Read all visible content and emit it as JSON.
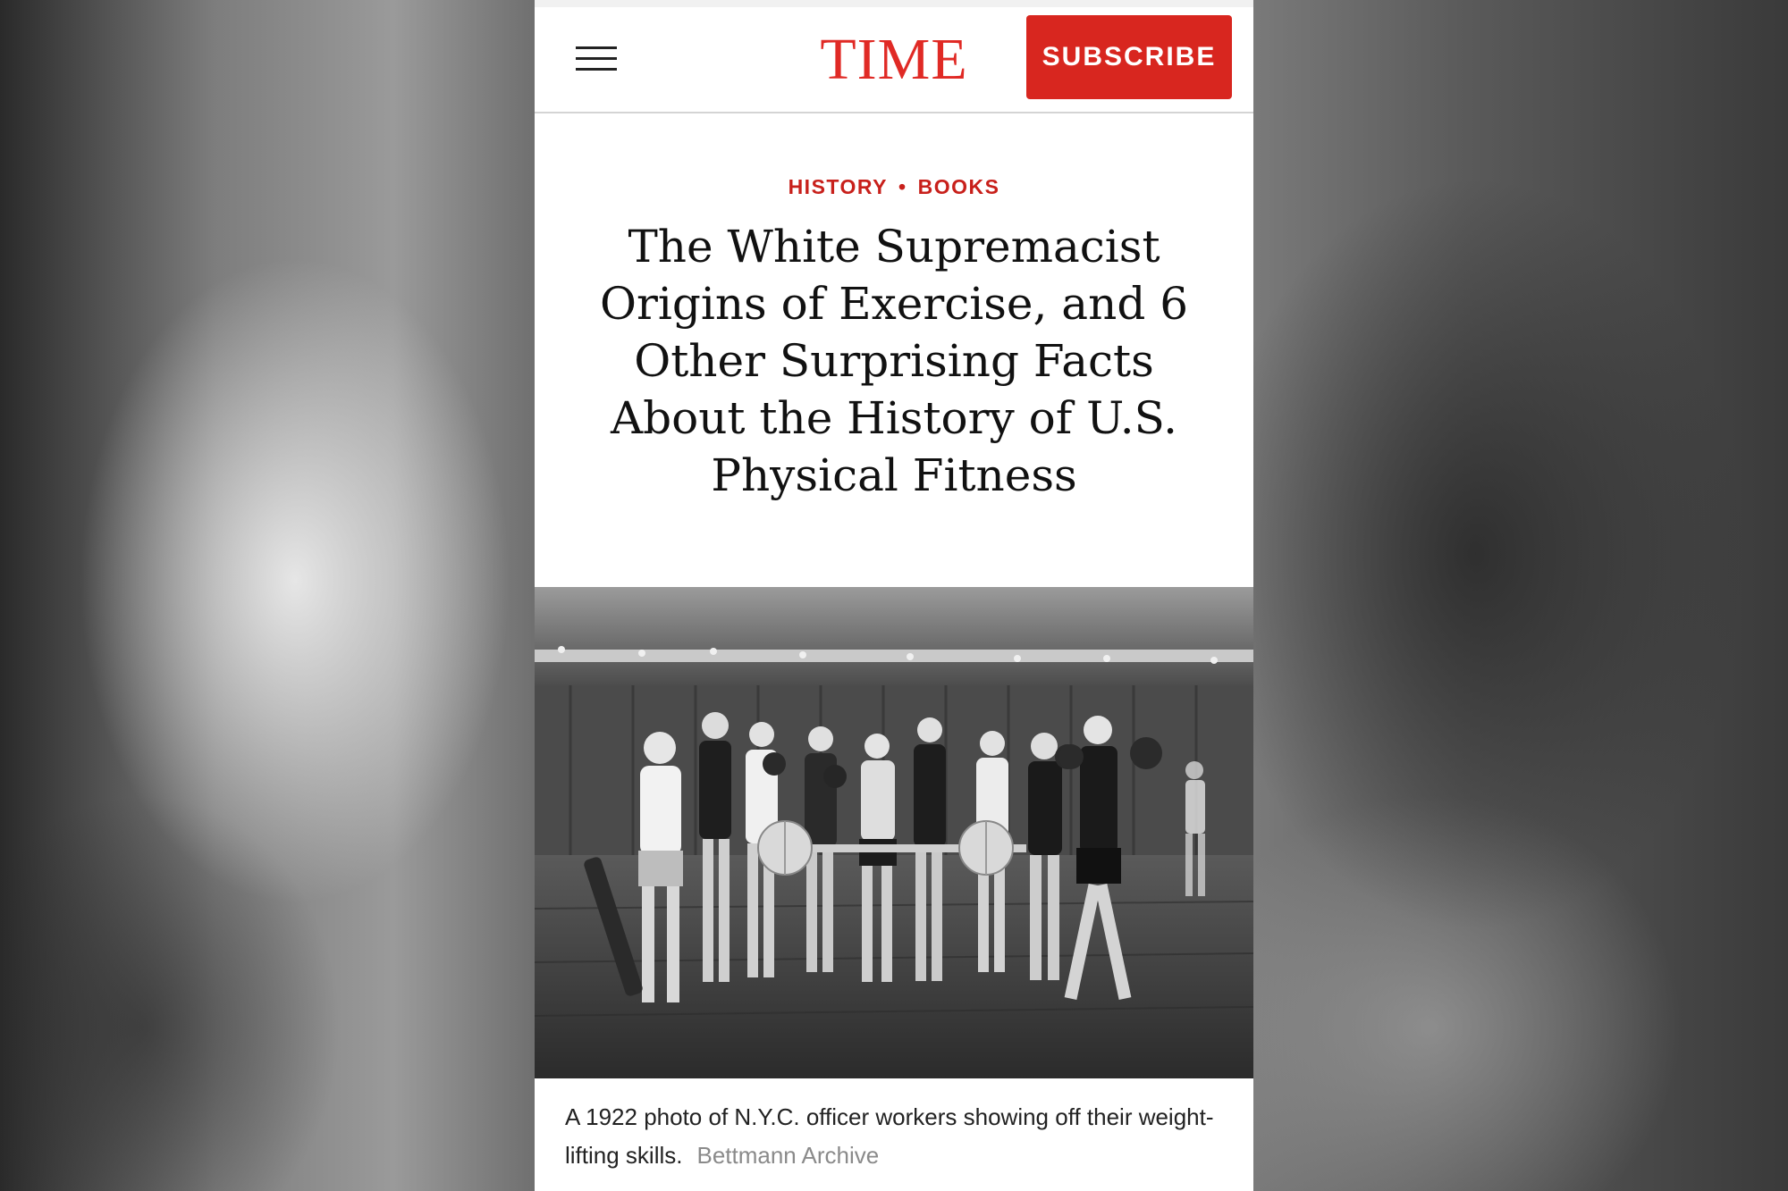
{
  "header": {
    "menu_icon": "hamburger-menu-icon",
    "logo_text": "TIME",
    "subscribe_label": "SUBSCRIBE",
    "brand_color": "#e02a25"
  },
  "article": {
    "categories": [
      "HISTORY",
      "BOOKS"
    ],
    "separator": "•",
    "headline": "The White Supremacist Origins of Exercise, and 6 Other Surprising Facts About the History of U.S. Physical Fitness",
    "image": {
      "description_icon": "photo-image",
      "caption": "A 1922 photo of N.Y.C. officer workers showing off their weight-lifting skills.",
      "credit": "Bettmann Archive"
    }
  }
}
